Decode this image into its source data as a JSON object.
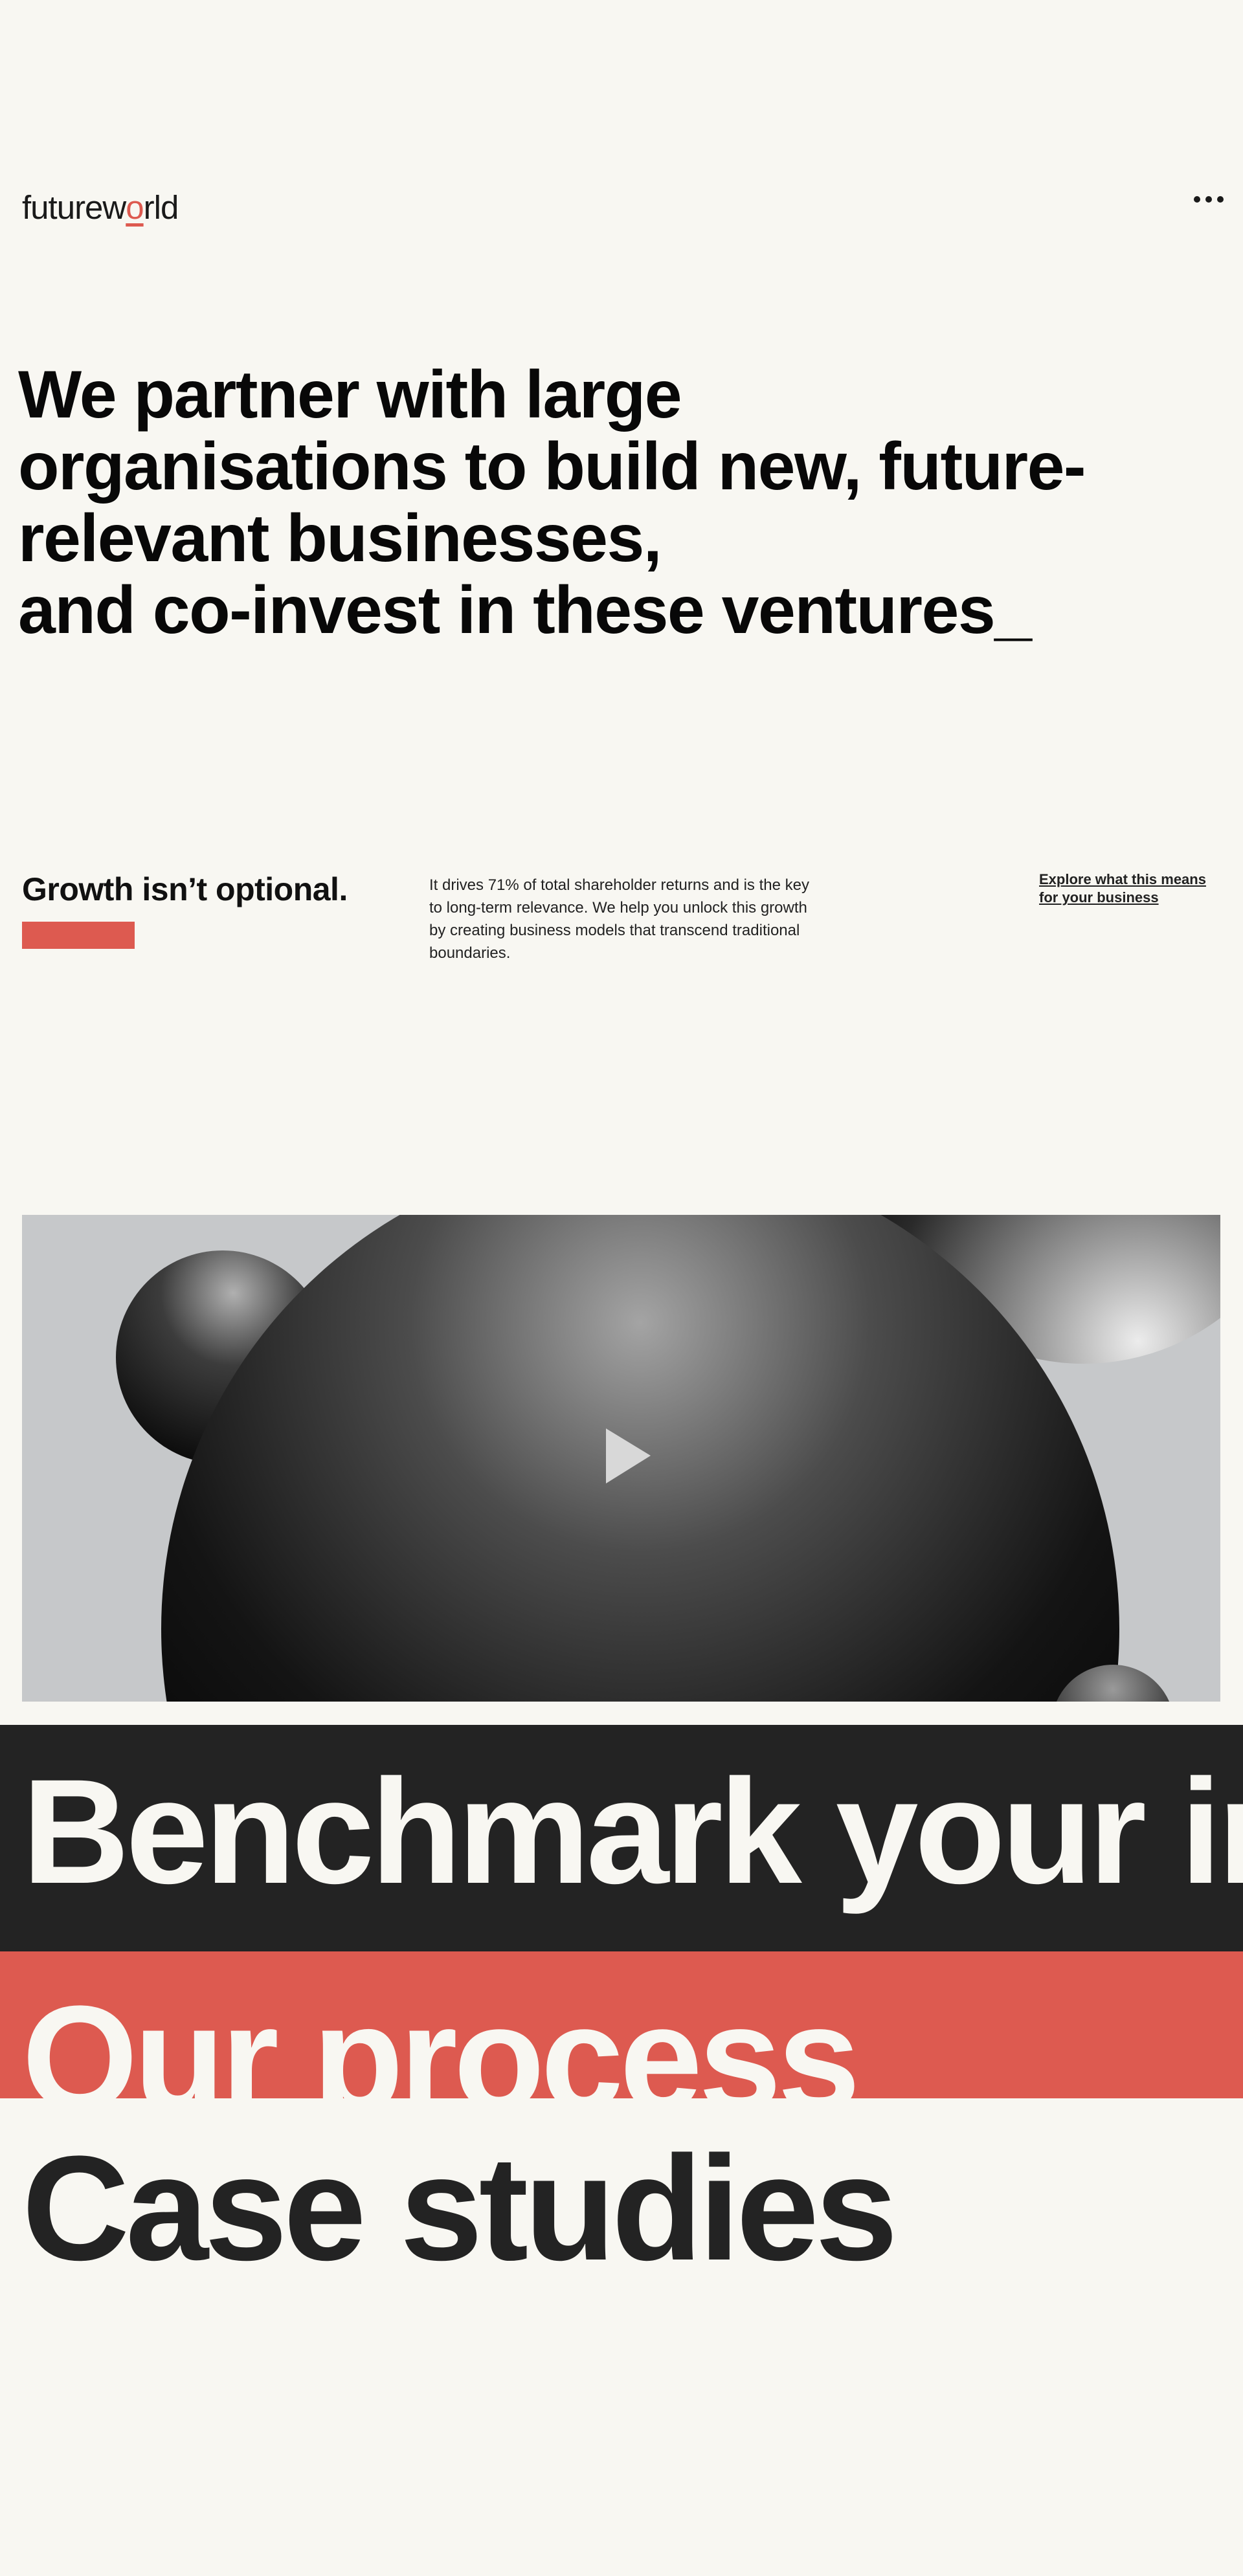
{
  "header": {
    "logo_prefix": "futurew",
    "logo_accent": "o",
    "logo_suffix": "rld",
    "menu_icon": "more-dots-icon"
  },
  "hero": {
    "lines": [
      "We partner with large",
      "organisations to build new, future-",
      "relevant businesses,",
      "and co-invest in these ventures_"
    ]
  },
  "growth": {
    "title": "Growth isn’t optional.",
    "body": "It drives 71% of total shareholder returns and is the key to long-term relevance. We help you unlock this growth by creating business models that transcend traditional boundaries.",
    "link": "Explore what this means for your business"
  },
  "video": {
    "icon": "play-icon"
  },
  "sections": {
    "benchmark": "Benchmark your innovation",
    "process": "Our process",
    "cases": "Case studies"
  },
  "colors": {
    "background": "#f8f7f2",
    "accent": "#dd5a50",
    "dark": "#232323"
  }
}
